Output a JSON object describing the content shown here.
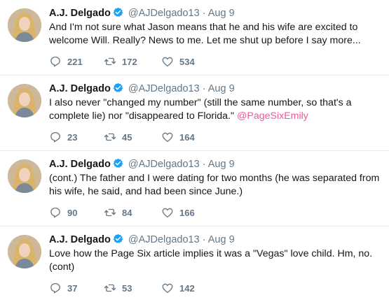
{
  "colors": {
    "mention": "#f2569b",
    "verified": "#1da1f2",
    "meta": "#657786",
    "text": "#14171a"
  },
  "icons": {
    "reply": "speech-bubble-icon",
    "retweet": "retweet-arrows-icon",
    "like": "heart-icon",
    "verified": "verified-badge-icon"
  },
  "tweets": [
    {
      "name": "A.J. Delgado",
      "handle": "@AJDelgado13",
      "separator": "·",
      "time": "Aug 9",
      "text": "And I'm not sure what Jason means that he and his wife are excited to welcome Will. Really? News to me. Let me shut up before I say more...",
      "mention": "",
      "replies": "221",
      "retweets": "172",
      "likes": "534"
    },
    {
      "name": "A.J. Delgado",
      "handle": "@AJDelgado13",
      "separator": "·",
      "time": "Aug 9",
      "text": "I also never \"changed my number\" (still the same number, so that's a complete lie) nor \"disappeared to Florida.\" ",
      "mention": "@PageSixEmily",
      "replies": "23",
      "retweets": "45",
      "likes": "164"
    },
    {
      "name": "A.J. Delgado",
      "handle": "@AJDelgado13",
      "separator": "·",
      "time": "Aug 9",
      "text": "(cont.) The father and I were dating for two months (he was separated from his wife, he said, and had been since June.)",
      "mention": "",
      "replies": "90",
      "retweets": "84",
      "likes": "166"
    },
    {
      "name": "A.J. Delgado",
      "handle": "@AJDelgado13",
      "separator": "·",
      "time": "Aug 9",
      "text": "Love how the Page Six article implies it was a \"Vegas\" love child. Hm, no. (cont)",
      "mention": "",
      "replies": "37",
      "retweets": "53",
      "likes": "142"
    }
  ]
}
